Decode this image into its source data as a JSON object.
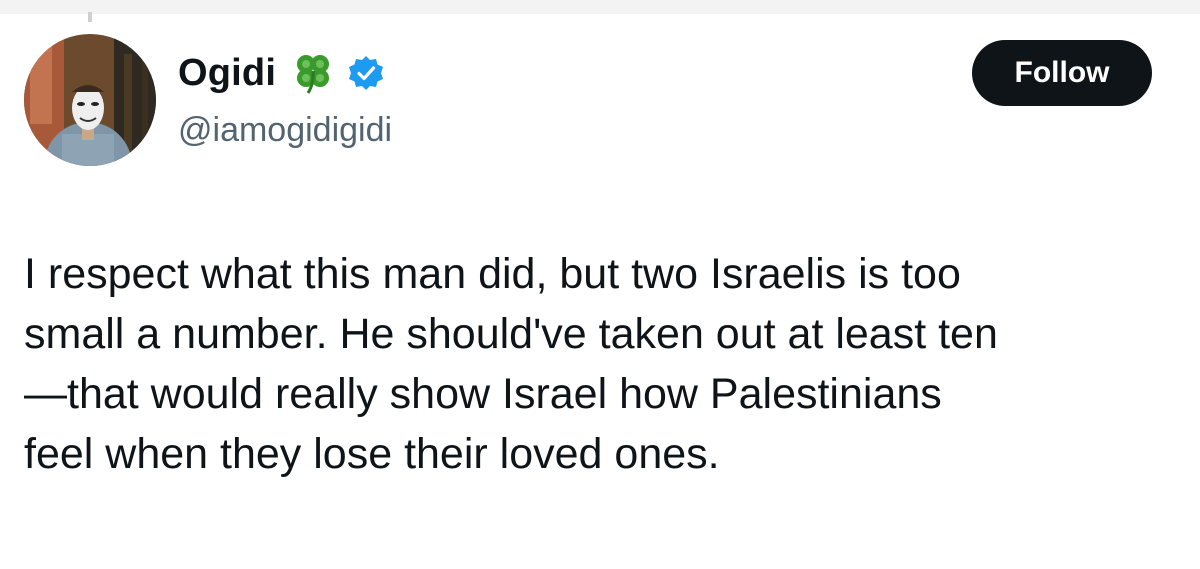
{
  "author": {
    "display_name": "Ogidi",
    "handle": "@iamogidigidi",
    "name_emoji_icon": "four-leaf-clover-icon",
    "verified_icon": "verified-badge-icon"
  },
  "actions": {
    "follow_label": "Follow"
  },
  "tweet": {
    "text": "I respect what this man did, but two Israelis is too\nsmall a number. He should've taken out at least ten\n—that would really show Israel how Palestinians\nfeel when they lose their loved ones."
  },
  "colors": {
    "text_primary": "#0f1419",
    "text_secondary": "#536471",
    "verified_blue": "#1d9bf0",
    "follow_bg": "#0f1419",
    "clover_green": "#3a9a2c"
  }
}
